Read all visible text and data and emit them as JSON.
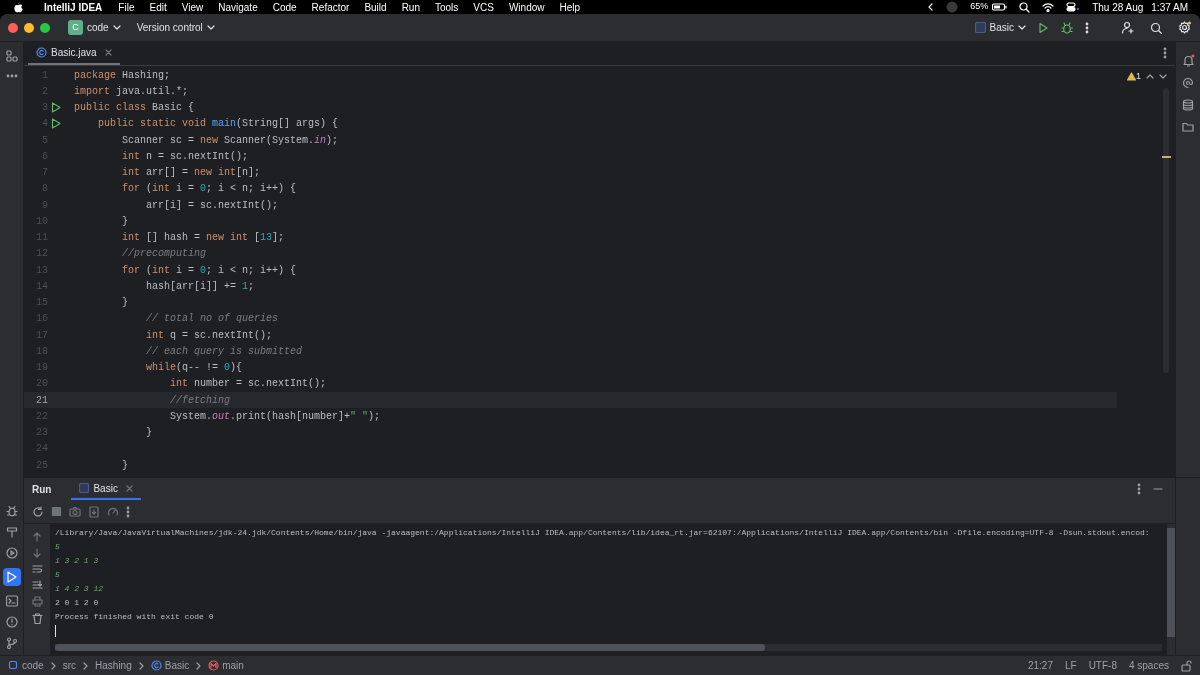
{
  "menu_bar": {
    "app": "IntelliJ IDEA",
    "items": [
      "File",
      "Edit",
      "View",
      "Navigate",
      "Code",
      "Refactor",
      "Build",
      "Run",
      "Tools",
      "VCS",
      "Window",
      "Help"
    ],
    "battery": "65%",
    "date": "Thu 28 Aug",
    "time": "1:37 AM"
  },
  "title_bar": {
    "project_badge": "C",
    "project": "code",
    "vcs": "Version control",
    "run_config": "Basic"
  },
  "editor_tabs": [
    {
      "label": "Basic.java",
      "selected": true
    }
  ],
  "inspections": {
    "warnings": "1"
  },
  "code_lines": [
    {
      "number": "1",
      "current": false,
      "run_marker": false,
      "tokens": [
        {
          "kind": "keyword",
          "text": "package"
        },
        {
          "kind": "plain",
          "text": " Hashing;"
        }
      ]
    },
    {
      "number": "2",
      "current": false,
      "run_marker": false,
      "tokens": [
        {
          "kind": "keyword",
          "text": "import"
        },
        {
          "kind": "plain",
          "text": " java.util.*;"
        }
      ]
    },
    {
      "number": "3",
      "current": false,
      "run_marker": true,
      "tokens": [
        {
          "kind": "keyword",
          "text": "public class"
        },
        {
          "kind": "plain",
          "text": " Basic {"
        }
      ]
    },
    {
      "number": "4",
      "current": false,
      "run_marker": true,
      "tokens": [
        {
          "kind": "keyword",
          "text": "    public static void "
        },
        {
          "kind": "method",
          "text": "main"
        },
        {
          "kind": "plain",
          "text": "(String[] args) {"
        }
      ]
    },
    {
      "number": "5",
      "current": false,
      "run_marker": false,
      "tokens": [
        {
          "kind": "plain",
          "text": "        Scanner sc = "
        },
        {
          "kind": "keyword",
          "text": "new"
        },
        {
          "kind": "plain",
          "text": " Scanner(System."
        },
        {
          "kind": "field",
          "text": "in"
        },
        {
          "kind": "plain",
          "text": ");"
        }
      ]
    },
    {
      "number": "6",
      "current": false,
      "run_marker": false,
      "tokens": [
        {
          "kind": "keyword",
          "text": "        int"
        },
        {
          "kind": "plain",
          "text": " n = sc.nextInt();"
        }
      ]
    },
    {
      "number": "7",
      "current": false,
      "run_marker": false,
      "tokens": [
        {
          "kind": "keyword",
          "text": "        int"
        },
        {
          "kind": "plain",
          "text": " arr[] = "
        },
        {
          "kind": "keyword",
          "text": "new int"
        },
        {
          "kind": "plain",
          "text": "[n];"
        }
      ]
    },
    {
      "number": "8",
      "current": false,
      "run_marker": false,
      "tokens": [
        {
          "kind": "keyword",
          "text": "        for"
        },
        {
          "kind": "plain",
          "text": " ("
        },
        {
          "kind": "keyword",
          "text": "int"
        },
        {
          "kind": "plain",
          "text": " i = "
        },
        {
          "kind": "number",
          "text": "0"
        },
        {
          "kind": "plain",
          "text": "; i < n; i++) {"
        }
      ]
    },
    {
      "number": "9",
      "current": false,
      "run_marker": false,
      "tokens": [
        {
          "kind": "plain",
          "text": "            arr[i] = sc.nextInt();"
        }
      ]
    },
    {
      "number": "10",
      "current": false,
      "run_marker": false,
      "tokens": [
        {
          "kind": "plain",
          "text": "        }"
        }
      ]
    },
    {
      "number": "11",
      "current": false,
      "run_marker": false,
      "tokens": [
        {
          "kind": "keyword",
          "text": "        int"
        },
        {
          "kind": "plain",
          "text": " [] hash = "
        },
        {
          "kind": "keyword",
          "text": "new int"
        },
        {
          "kind": "plain",
          "text": " ["
        },
        {
          "kind": "number",
          "text": "13"
        },
        {
          "kind": "plain",
          "text": "];"
        }
      ]
    },
    {
      "number": "12",
      "current": false,
      "run_marker": false,
      "tokens": [
        {
          "kind": "comment",
          "text": "        //precomputing"
        }
      ]
    },
    {
      "number": "13",
      "current": false,
      "run_marker": false,
      "tokens": [
        {
          "kind": "keyword",
          "text": "        for"
        },
        {
          "kind": "plain",
          "text": " ("
        },
        {
          "kind": "keyword",
          "text": "int"
        },
        {
          "kind": "plain",
          "text": " i = "
        },
        {
          "kind": "number",
          "text": "0"
        },
        {
          "kind": "plain",
          "text": "; i < n; i++) {"
        }
      ]
    },
    {
      "number": "14",
      "current": false,
      "run_marker": false,
      "tokens": [
        {
          "kind": "plain",
          "text": "            hash[arr[i]] += "
        },
        {
          "kind": "number",
          "text": "1"
        },
        {
          "kind": "plain",
          "text": ";"
        }
      ]
    },
    {
      "number": "15",
      "current": false,
      "run_marker": false,
      "tokens": [
        {
          "kind": "plain",
          "text": "        }"
        }
      ]
    },
    {
      "number": "16",
      "current": false,
      "run_marker": false,
      "tokens": [
        {
          "kind": "comment",
          "text": "            // total no of queries"
        }
      ]
    },
    {
      "number": "17",
      "current": false,
      "run_marker": false,
      "tokens": [
        {
          "kind": "keyword",
          "text": "            int"
        },
        {
          "kind": "plain",
          "text": " q = sc.nextInt();"
        }
      ]
    },
    {
      "number": "18",
      "current": false,
      "run_marker": false,
      "tokens": [
        {
          "kind": "comment",
          "text": "            // each query is submitted"
        }
      ]
    },
    {
      "number": "19",
      "current": false,
      "run_marker": false,
      "tokens": [
        {
          "kind": "keyword",
          "text": "            while"
        },
        {
          "kind": "plain",
          "text": "(q-- != "
        },
        {
          "kind": "number",
          "text": "0"
        },
        {
          "kind": "plain",
          "text": "){"
        }
      ]
    },
    {
      "number": "20",
      "current": false,
      "run_marker": false,
      "tokens": [
        {
          "kind": "keyword",
          "text": "                int"
        },
        {
          "kind": "plain",
          "text": " number = sc.nextInt();"
        }
      ]
    },
    {
      "number": "21",
      "current": true,
      "run_marker": false,
      "tokens": [
        {
          "kind": "comment",
          "text": "                //fetching"
        }
      ]
    },
    {
      "number": "22",
      "current": false,
      "run_marker": false,
      "tokens": [
        {
          "kind": "plain",
          "text": "                System."
        },
        {
          "kind": "field",
          "text": "out"
        },
        {
          "kind": "plain",
          "text": ".print(hash[number]+"
        },
        {
          "kind": "string",
          "text": "\" \""
        },
        {
          "kind": "plain",
          "text": ");"
        }
      ]
    },
    {
      "number": "23",
      "current": false,
      "run_marker": false,
      "tokens": [
        {
          "kind": "plain",
          "text": "            }"
        }
      ]
    },
    {
      "number": "24",
      "current": false,
      "run_marker": false
    },
    {
      "number": "25",
      "current": false,
      "run_marker": false,
      "tokens": [
        {
          "kind": "plain",
          "text": "        }"
        }
      ]
    }
  ],
  "run_panel": {
    "title": "Run",
    "tabs": [
      {
        "label": "Basic",
        "selected": true
      }
    ],
    "console": [
      {
        "kind": "command",
        "text": "/Library/Java/JavaVirtualMachines/jdk-24.jdk/Contents/Home/bin/java -javaagent:/Applications/IntelliJ IDEA.app/Contents/lib/idea_rt.jar=62107:/Applications/IntelliJ IDEA.app/Contents/bin -Dfile.encoding=UTF-8 -Dsun.stdout.encod:"
      },
      {
        "kind": "input",
        "text": "5"
      },
      {
        "kind": "input",
        "text": "1 3 2 1 3"
      },
      {
        "kind": "input",
        "text": "5"
      },
      {
        "kind": "input",
        "text": "1 4 2 3 12"
      },
      {
        "kind": "output",
        "text": "2 0 1 2 0"
      },
      {
        "kind": "output",
        "text": "Process finished with exit code 0"
      }
    ]
  },
  "status_bar": {
    "breadcrumbs": [
      {
        "kind": "module",
        "text": "code"
      },
      {
        "kind": "folder",
        "text": "src"
      },
      {
        "kind": "package",
        "text": "Hashing"
      },
      {
        "kind": "class",
        "text": "Basic"
      },
      {
        "kind": "method",
        "text": "main"
      }
    ],
    "position": "21:27",
    "line_separator": "LF",
    "encoding": "UTF-8",
    "indent": "4 spaces"
  }
}
